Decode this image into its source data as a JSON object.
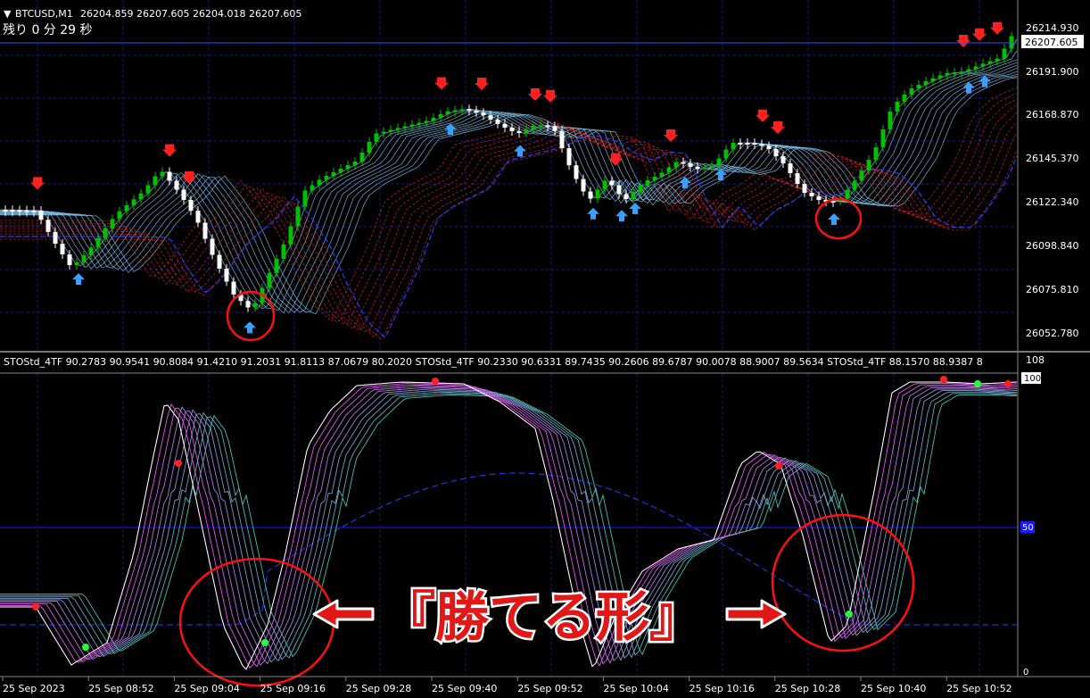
{
  "header": {
    "symbol": "BTCUSD,M1",
    "ohlc": "26204.859 26207.605 26204.018 26207.605",
    "countdown": "残り 0 分 29 秒"
  },
  "price_axis": {
    "ticks": [
      "26214.930",
      "26191.900",
      "26168.870",
      "26145.370",
      "26122.340",
      "26098.840",
      "26075.810",
      "26052.780"
    ],
    "current_price": "26207.605"
  },
  "indicator": {
    "label": "STOStd_4TF 90.2783 90.9541 90.8084 91.4210 91.2031 91.8113 87.0679 80.2020  STOStd_4TF 90.2330 90.6331 89.7435 90.2606 89.6787 90.0078 88.9007 89.5634  STOStd_4TF 88.1570 88.9387 8",
    "axis_top": "108",
    "level_100": "100",
    "level_50": "50",
    "axis_bottom": "0"
  },
  "time_axis": [
    "25 Sep 2023",
    "25 Sep 08:52",
    "25 Sep 09:04",
    "25 Sep 09:16",
    "25 Sep 09:28",
    "25 Sep 09:40",
    "25 Sep 09:52",
    "25 Sep 10:04",
    "25 Sep 10:16",
    "25 Sep 10:28",
    "25 Sep 10:40",
    "25 Sep 10:52"
  ],
  "annotation": {
    "text": "『勝てる形』"
  },
  "colors": {
    "up_candle": "#00c000",
    "down_candle": "#ffffff",
    "bull_ribbon": "#87cefa",
    "bear_ribbon": "#ff2a2a",
    "sto_fast": "#ff44ff",
    "sto_slow": "#40c0b0",
    "callout": "#e01818",
    "grid": "#1c1c6c"
  }
}
